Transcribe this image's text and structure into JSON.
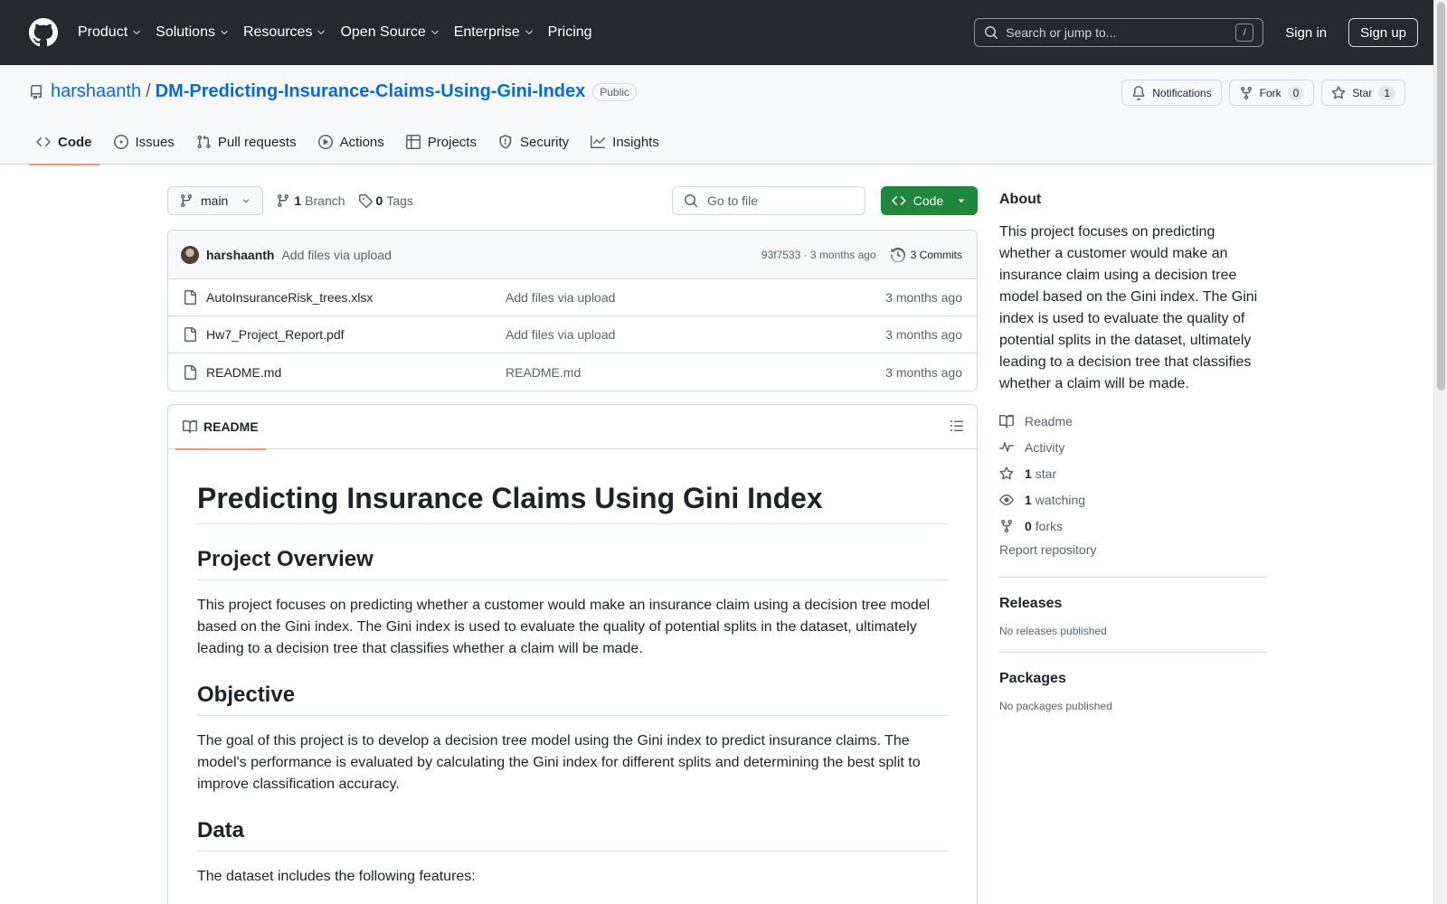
{
  "header": {
    "nav": [
      {
        "label": "Product",
        "has_menu": true
      },
      {
        "label": "Solutions",
        "has_menu": true
      },
      {
        "label": "Resources",
        "has_menu": true
      },
      {
        "label": "Open Source",
        "has_menu": true
      },
      {
        "label": "Enterprise",
        "has_menu": true
      },
      {
        "label": "Pricing",
        "has_menu": false
      }
    ],
    "search_placeholder": "Search or jump to...",
    "search_shortcut": "/",
    "sign_in": "Sign in",
    "sign_up": "Sign up"
  },
  "repo": {
    "owner": "harshaanth",
    "separator": "/",
    "name": "DM-Predicting-Insurance-Claims-Using-Gini-Index",
    "visibility": "Public",
    "actions": {
      "notifications": "Notifications",
      "fork": "Fork",
      "fork_count": "0",
      "star": "Star",
      "star_count": "1"
    },
    "tabs": [
      {
        "label": "Code",
        "icon": "code-icon",
        "active": true
      },
      {
        "label": "Issues",
        "icon": "issue-icon"
      },
      {
        "label": "Pull requests",
        "icon": "pull-request-icon"
      },
      {
        "label": "Actions",
        "icon": "play-icon"
      },
      {
        "label": "Projects",
        "icon": "table-icon"
      },
      {
        "label": "Security",
        "icon": "shield-icon"
      },
      {
        "label": "Insights",
        "icon": "graph-icon"
      }
    ]
  },
  "file_nav": {
    "branch": "main",
    "branch_count": "1",
    "branch_label": "Branch",
    "tag_count": "0",
    "tag_label": "Tags",
    "goto_placeholder": "Go to file",
    "code_button": "Code"
  },
  "latest_commit": {
    "author": "harshaanth",
    "message": "Add files via upload",
    "sha_time": "93f7533 · 3 months ago",
    "commits_label": "3 Commits"
  },
  "files": [
    {
      "name": "AutoInsuranceRisk_trees.xlsx",
      "message": "Add files via upload",
      "date": "3 months ago"
    },
    {
      "name": "Hw7_Project_Report.pdf",
      "message": "Add files via upload",
      "date": "3 months ago"
    },
    {
      "name": "README.md",
      "message": "README.md",
      "date": "3 months ago"
    }
  ],
  "readme": {
    "tab_label": "README",
    "title": "Predicting Insurance Claims Using Gini Index",
    "sections": [
      {
        "heading": "Project Overview",
        "text": "This project focuses on predicting whether a customer would make an insurance claim using a decision tree model based on the Gini index. The Gini index is used to evaluate the quality of potential splits in the dataset, ultimately leading to a decision tree that classifies whether a claim will be made."
      },
      {
        "heading": "Objective",
        "text": "The goal of this project is to develop a decision tree model using the Gini index to predict insurance claims. The model's performance is evaluated by calculating the Gini index for different splits and determining the best split to improve classification accuracy."
      },
      {
        "heading": "Data",
        "text": "The dataset includes the following features:"
      }
    ]
  },
  "sidebar": {
    "about_title": "About",
    "description": "This project focuses on predicting whether a customer would make an insurance claim using a decision tree model based on the Gini index. The Gini index is used to evaluate the quality of potential splits in the dataset, ultimately leading to a decision tree that classifies whether a claim will be made.",
    "readme": "Readme",
    "activity": "Activity",
    "stars_count": "1",
    "stars_label": "star",
    "watching_count": "1",
    "watching_label": "watching",
    "forks_count": "0",
    "forks_label": "forks",
    "report": "Report repository",
    "releases_title": "Releases",
    "releases_empty": "No releases published",
    "packages_title": "Packages",
    "packages_empty": "No packages published"
  },
  "colors": {
    "header_bg": "#25292e",
    "link_blue": "#0969da",
    "code_green": "#1f883d",
    "tab_underline": "#fd8c73"
  }
}
